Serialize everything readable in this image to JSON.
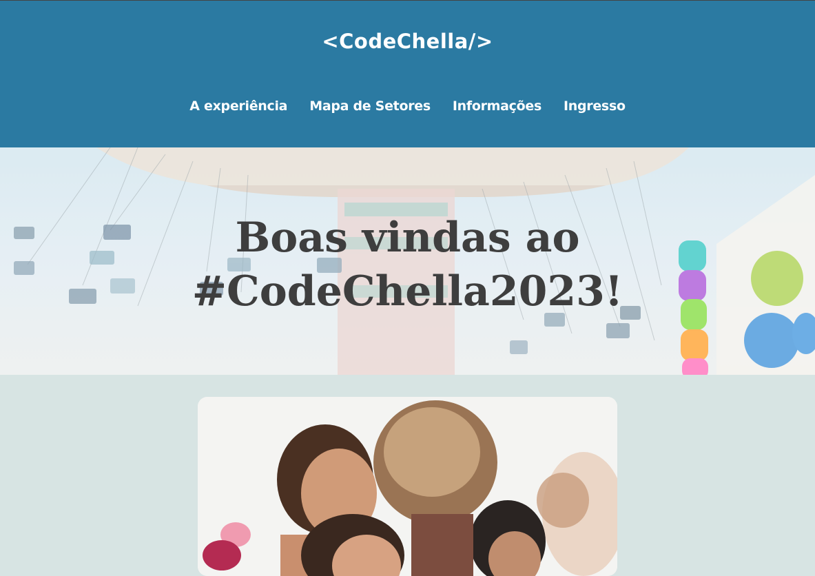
{
  "header": {
    "logo": "<CodeChella/>",
    "nav": [
      {
        "label": "A experiência"
      },
      {
        "label": "Mapa de Setores"
      },
      {
        "label": "Informações"
      },
      {
        "label": "Ingresso"
      }
    ]
  },
  "hero": {
    "title_line1": "Boas vindas ao",
    "title_line2": "#CodeChella2023!"
  },
  "colors": {
    "header_bg": "#2b7aa2",
    "page_bg": "#d7e4e3",
    "title_text": "#3e3e3e"
  }
}
